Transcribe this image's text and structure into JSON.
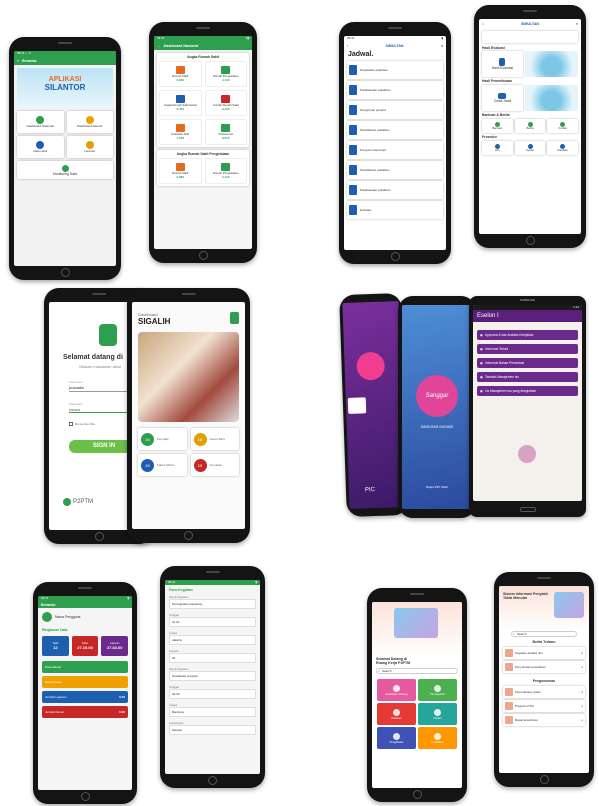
{
  "colors": {
    "green": "#2e9e4f",
    "blue": "#1f5fb0",
    "purple": "#6a2a8c",
    "peach": "#f7d2c4"
  },
  "p1": {
    "status": "09:41 ⋯ ▾",
    "title": "Beranda",
    "banner1": "APLIKASI",
    "banner2": "SILANTOR",
    "menu": [
      {
        "label": "Dashboard Nasional",
        "icon": "chart-icon"
      },
      {
        "label": "Dashboard Daerah",
        "icon": "sun-icon"
      },
      {
        "label": "Data Hasil",
        "icon": "cloud-icon"
      },
      {
        "label": "Laporan",
        "icon": "doc-icon"
      }
    ],
    "wide": "Monitoring Data"
  },
  "p2": {
    "title": "Dashboard Nasional",
    "section": "Angka Rumah Sakit",
    "tiles": [
      {
        "label": "Rumah Sakit",
        "value": "2,980"
      },
      {
        "label": "Rumah Pengelolaan",
        "value": "4,120"
      },
      {
        "label": "Angka Rumah Sakit Sehat",
        "value": "2,450"
      },
      {
        "label": "Jumlah Rumah Sakit",
        "value": "3,120"
      },
      {
        "label": "Kawasan Aktif",
        "value": "1,550"
      },
      {
        "label": "Puskesmas",
        "value": "8,010"
      }
    ],
    "section2": "Angka Rumah Sakit Pengelolaan",
    "tiles2": [
      {
        "label": "Rumah Sakit",
        "value": "2,980"
      },
      {
        "label": "Rumah Pengelolaan",
        "value": "4,120"
      }
    ]
  },
  "p3": {
    "title": "SIMULTAN",
    "heading": "Jadwal.",
    "items": [
      "Penjelasan pelatihan",
      "Pelaksanaan pelatihan",
      "Pengiriman peserta",
      "Pendaftaran pelatihan",
      "Pengumuman hasil",
      "Pendaftaran pelatihan",
      "Pelaksanaan pelatihan",
      "Evaluasi"
    ]
  },
  "p4": {
    "title": "SIMULTAN",
    "sec1": "Hasil Evaluasi",
    "btn1": "Hasil Evaluasi",
    "sec2": "Hasil Pemeriksaan",
    "btn2": "Cetak Hasil",
    "sec3": "Bantuan & Berita",
    "sec4": "Prosedur",
    "icons3": [
      "Bantuan",
      "Berita",
      "Kontak"
    ],
    "icons4": [
      "Alur",
      "Syarat",
      "Panduan"
    ]
  },
  "p5": {
    "welcome": "Selamat datang di",
    "sub": "Silakan masukkan akun",
    "field1_label": "Username",
    "field1": "pusdatin",
    "field2_label": "Password",
    "field2": "••••••••",
    "remember": "Remember Me",
    "signin": "SIGN IN",
    "footer": "P2PTM"
  },
  "p6": {
    "small": "Dashboard",
    "title": "SIGALIH",
    "stats": [
      {
        "value": "34",
        "label": "Penyakit",
        "color": "#2e9e4f"
      },
      {
        "value": "16",
        "label": "Kasus Baru",
        "color": "#e0a100"
      },
      {
        "value": "15",
        "label": "Faktor Risiko",
        "color": "#1f5fb0"
      },
      {
        "value": "10",
        "label": "Kematian",
        "color": "#c62828"
      }
    ]
  },
  "p7": {
    "label": "PIC"
  },
  "p8": {
    "logo": "Sanggar",
    "tagline": "SANGGAR INOVASI",
    "footer": "Ditjen P2P 2022"
  },
  "p9": {
    "brand": "SAMSUNG",
    "status": "1:12",
    "title": "Eselon I",
    "menu": [
      "Approval & dan Analisis Kebijakan",
      "Informasi Terkini",
      "Informasi Bahan Presentasi",
      "Tambah Manajemen Isu",
      "Lis Manajemen Isu yang diregistrasi"
    ]
  },
  "p10": {
    "title": "Beranda",
    "name": "Nama Pengguna",
    "sec": "Ringkasan Data",
    "stats": [
      {
        "label": "Total",
        "value": "12",
        "color": "#1f5fb0"
      },
      {
        "label": "Data",
        "value": "27.10.00",
        "color": "#c62828"
      },
      {
        "label": "Laporan",
        "value": "27.63.00",
        "color": "#6a2a8c"
      }
    ],
    "rows": [
      {
        "label": "Data Masuk",
        "value": "",
        "color": "#2e9e4f"
      },
      {
        "label": "Data Proses",
        "value": "",
        "color": "#f0a000"
      },
      {
        "label": "Jumlah Laporan",
        "value": "0.00",
        "color": "#1f5fb0"
      },
      {
        "label": "Jumlah Revisi",
        "value": "0.00",
        "color": "#c62828"
      }
    ]
  },
  "p11": {
    "header": "Form Kegiatan",
    "fields": [
      {
        "label": "Nama Kegiatan",
        "value": "Peningkatan kapasitas"
      },
      {
        "label": "Tanggal",
        "value": "01-01"
      },
      {
        "label": "Lokasi",
        "value": "Jakarta"
      },
      {
        "label": "Peserta",
        "value": "30"
      },
      {
        "label": "Nama Kegiatan",
        "value": "Sosialisasi program"
      },
      {
        "label": "Tanggal",
        "value": "02-02"
      },
      {
        "label": "Lokasi",
        "value": "Bandung"
      },
      {
        "label": "Keterangan",
        "value": "Selesai"
      }
    ]
  },
  "p12": {
    "title": "Selamat Datang di Ruang Kerja P2PTM",
    "search": "Search",
    "tiles": [
      {
        "label": "Kesehatan Jantung",
        "color": "#e65aa0"
      },
      {
        "label": "Pencegahan",
        "color": "#4caf50"
      },
      {
        "label": "Diabetes",
        "color": "#e53935"
      },
      {
        "label": "Kanker",
        "color": "#26a69a"
      },
      {
        "label": "Penglihatan",
        "color": "#3f51b5"
      },
      {
        "label": "Konsultasi",
        "color": "#ff9800"
      }
    ]
  },
  "p13": {
    "title": "Sistem Informasi Penyakit Tidak Menular",
    "search": "Search",
    "sec1": "Berita Terbaru",
    "sec2": "Pengumuman",
    "items": [
      "Kegiatan deteksi dini",
      "Penyuluhan kesehatan",
      "Pemeriksaan gratis",
      "Program PTM",
      "Rapat koordinasi"
    ]
  }
}
